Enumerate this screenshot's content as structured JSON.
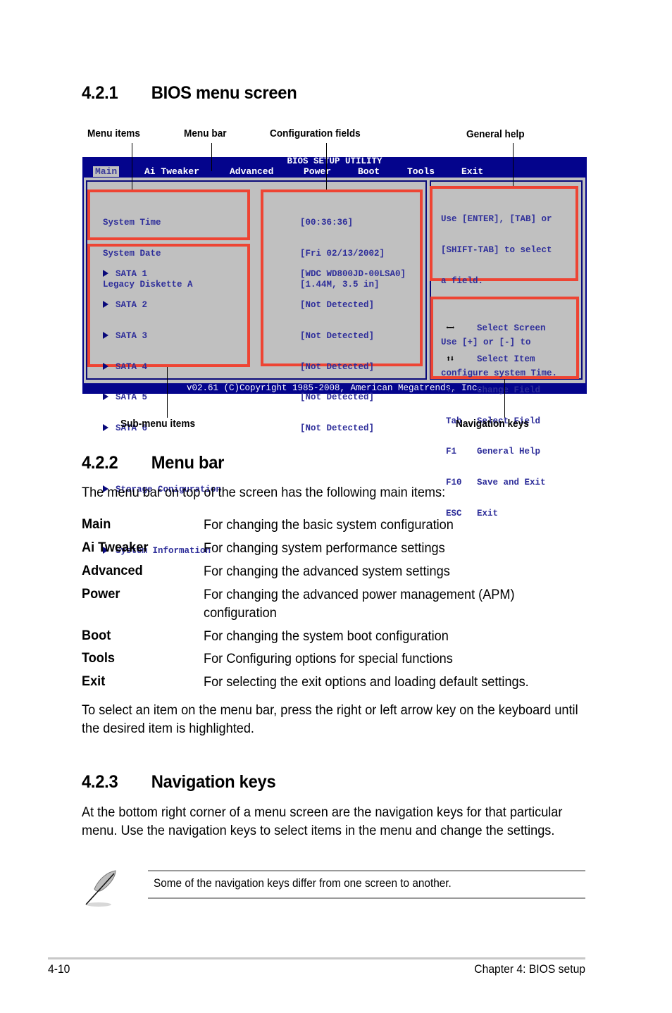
{
  "sections": {
    "s421": {
      "number": "4.2.1",
      "title": "BIOS menu screen"
    },
    "s422": {
      "number": "4.2.2",
      "title": "Menu bar"
    },
    "s423": {
      "number": "4.2.3",
      "title": "Navigation keys"
    }
  },
  "callouts": {
    "menu_items": "Menu items",
    "menu_bar": "Menu bar",
    "configuration_fields": "Configuration fields",
    "general_help": "General help",
    "sub_menu_items": "Sub-menu items",
    "navigation_keys": "Navigation keys"
  },
  "bios": {
    "title": "BIOS SETUP UTILITY",
    "menu": [
      "Main",
      "Ai Tweaker",
      "Advanced",
      "Power",
      "Boot",
      "Tools",
      "Exit"
    ],
    "active_menu": "Main",
    "menu_items": [
      "System Time",
      "System Date",
      "Legacy Diskette A"
    ],
    "config_values": [
      "[00:36:36]",
      "[Fri 02/13/2002]",
      "[1.44M, 3.5 in]"
    ],
    "sub_menu_items": [
      "SATA 1",
      "SATA 2",
      "SATA 3",
      "SATA 4",
      "SATA 5",
      "SATA 6",
      "Storage Coniguration",
      "System Information"
    ],
    "sata_values": [
      "[WDC WD800JD-00LSA0]",
      "[Not Detected]",
      "[Not Detected]",
      "[Not Detected]",
      "[Not Detected]",
      "[Not Detected]"
    ],
    "help_text": [
      "Use [ENTER], [TAB] or",
      "[SHIFT-TAB] to select",
      "a field.",
      "",
      "Use [+] or [-] to",
      "configure system Time."
    ],
    "nav_keys": [
      {
        "key": "left-right-arrows",
        "label": "Select Screen"
      },
      {
        "key": "up-down-arrows",
        "label": "Select Item"
      },
      {
        "key": "+-",
        "label": "Change Field"
      },
      {
        "key": "Tab",
        "label": "Select Field"
      },
      {
        "key": "F1",
        "label": "General Help"
      },
      {
        "key": "F10",
        "label": "Save and Exit"
      },
      {
        "key": "ESC",
        "label": "Exit"
      }
    ],
    "footer": "v02.61 (C)Copyright 1985-2008, American Megatrends, Inc.",
    "colors": {
      "background": "#04048c",
      "panel": "#c0c0c0",
      "text": "#2e2e9a",
      "highlight_box": "#ee4433"
    }
  },
  "menu_bar_section": {
    "intro": "The menu bar on top of the screen has the following main items:",
    "items": [
      {
        "term": "Main",
        "desc": "For changing the basic system configuration"
      },
      {
        "term": "Ai Tweaker",
        "desc": "For changing system performance settings"
      },
      {
        "term": "Advanced",
        "desc": "For changing the advanced system settings"
      },
      {
        "term": "Power",
        "desc": "For changing the advanced power management (APM) configuration"
      },
      {
        "term": "Boot",
        "desc": "For changing the system boot configuration"
      },
      {
        "term": "Tools",
        "desc": "For Configuring options for special functions"
      },
      {
        "term": "Exit",
        "desc": "For selecting the exit options and loading default settings."
      }
    ],
    "outro": "To select an item on the menu bar, press the right or left arrow key on the keyboard until the desired item is highlighted."
  },
  "nav_section": {
    "paragraph": "At the bottom right corner of a menu screen are the navigation keys for that particular menu. Use the navigation keys to select items in the menu and change the settings.",
    "note": "Some of the navigation keys differ from one screen to another.",
    "note_icon": "feather-pen-icon"
  },
  "page_footer": {
    "page_number": "4-10",
    "chapter": "Chapter 4: BIOS setup"
  }
}
